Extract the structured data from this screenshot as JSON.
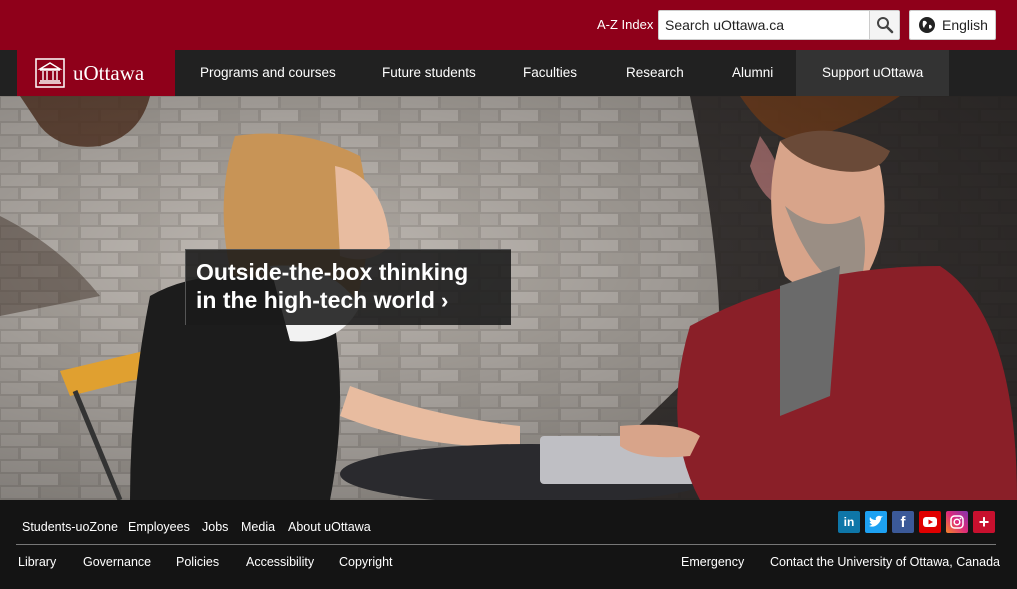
{
  "utility_bar": {
    "az_index": "A-Z Index",
    "search_placeholder": "Search uOttawa.ca",
    "language_button": "English"
  },
  "brand": {
    "logo_text": "uOttawa"
  },
  "nav": {
    "items": [
      "Programs and courses",
      "Future students",
      "Faculties",
      "Research",
      "Alumni"
    ],
    "support": "Support uOttawa"
  },
  "hero": {
    "headline_line1": "Outside-the-box thinking",
    "headline_line2": "in the high-tech world"
  },
  "footer": {
    "row1_links": [
      "Students-uoZone",
      "Employees",
      "Jobs",
      "Media",
      "About uOttawa"
    ],
    "row2_links": [
      "Library",
      "Governance",
      "Policies",
      "Accessibility",
      "Copyright"
    ],
    "right_links": [
      "Emergency",
      "Contact the University of Ottawa, Canada"
    ],
    "social_icons": [
      "linkedin-icon",
      "twitter-icon",
      "facebook-icon",
      "youtube-icon",
      "instagram-icon",
      "more-social-icon"
    ]
  },
  "colors": {
    "brand_red": "#8f001a",
    "nav_dark": "#212121",
    "linkedin": "#0e76a8",
    "twitter": "#1da1f2",
    "facebook": "#3b5998",
    "youtube": "#e00000",
    "instagram": "#c13584",
    "more": "#c8102e"
  }
}
